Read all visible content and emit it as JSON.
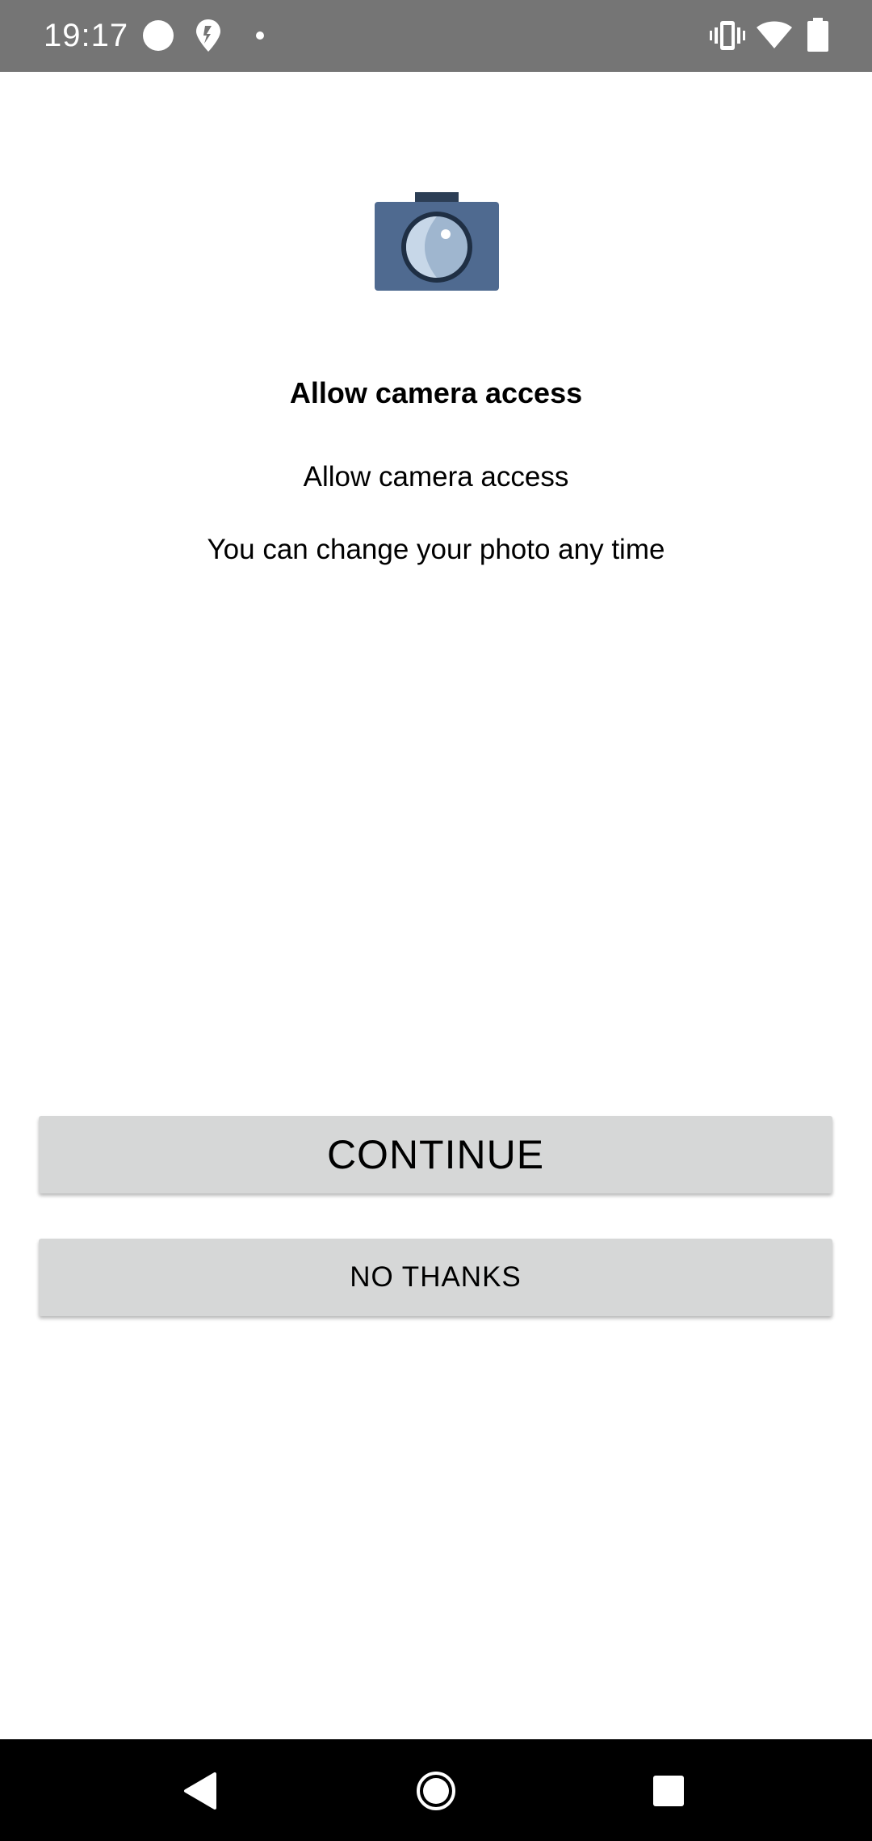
{
  "status_bar": {
    "time": "19:17",
    "icons": [
      "circle-notification-icon",
      "drop-notification-icon",
      "more-dot-icon",
      "vibrate-icon",
      "wifi-icon",
      "battery-icon"
    ]
  },
  "illustration": {
    "icon": "camera-icon",
    "colors": {
      "body": "#4f6a90",
      "top": "#2c3e55",
      "lens_ring": "#1f2f44",
      "lens": "#9fb6cf",
      "lens_light": "#c7d7e8"
    }
  },
  "content": {
    "title": "Allow camera access",
    "subtitle": "Allow camera access",
    "body": "You can change your photo any time"
  },
  "actions": {
    "continue_label": "CONTINUE",
    "no_thanks_label": "NO THANKS"
  },
  "colors": {
    "status_bar_bg": "#757575",
    "button_bg": "#d6d7d7",
    "nav_bar_bg": "#000000"
  },
  "nav_bar": {
    "icons": [
      "back-icon",
      "home-icon",
      "recents-icon"
    ]
  }
}
